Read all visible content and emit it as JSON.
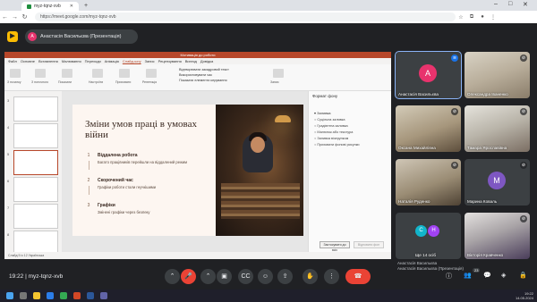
{
  "browser": {
    "tab_title": "myz-tqnz-xvb",
    "url": "https://meet.google.com/myz-tqnz-xvb",
    "new_tab": "+",
    "win_controls": [
      "–",
      "□",
      "✕"
    ],
    "nav": [
      "←",
      "→",
      "↻"
    ]
  },
  "meet": {
    "presenter_label": "Анастасія Васильєва (Презентація)",
    "presenter_initial": "А",
    "meeting_code": "myz-tqnz-xvb",
    "time": "19:22",
    "separator": "|",
    "pres_note": [
      "Анастасія Васильєва",
      "Анастасія Васильєва (Презентація)"
    ],
    "participant_count": "23"
  },
  "powerpoint": {
    "window_title": "Мотивація до роботи",
    "menu": [
      "Файл",
      "Основне",
      "Вставлення",
      "Малювання",
      "Переходи",
      "Анімація",
      "Слайд-шоу",
      "Запис",
      "Рецензування",
      "Вигляд",
      "Довідка"
    ],
    "active_menu": "Слайд-шоу",
    "ribbon_labels": [
      "З початку",
      "З поточного",
      "Показати",
      "Настроїти",
      "Приховати",
      "Репетиція",
      "Запис"
    ],
    "ribbon_checks": [
      "Відтворювати закадровий текст",
      "Використовувати час",
      "Показати елементи керування"
    ],
    "status": "Слайд 5 із 12   Українська",
    "slide_numbers": [
      "3",
      "4",
      "5",
      "6",
      "7",
      "8"
    ],
    "design_pane": {
      "title": "Формат фону",
      "section": "▾ Заливка",
      "options": [
        "Суцільна заливка",
        "Градієнтна заливка",
        "Малюнок або текстура",
        "Заливка візерунком",
        "Приховати фонові рисунки"
      ],
      "apply_all": "Застосувати до всіх",
      "reset": "Відновити фон"
    },
    "slide": {
      "title": "Зміни умов праці в умовах війни",
      "items": [
        {
          "num": "1",
          "head": "Віддалена робота",
          "desc": "Багато працівників перейшли на віддалений режим"
        },
        {
          "num": "2",
          "head": "Скорочений час",
          "desc": "Графіки роботи стали гнучкішими"
        },
        {
          "num": "3",
          "head": "Графіки",
          "desc": "Змінені графіки через безпеку"
        }
      ]
    }
  },
  "participants": [
    {
      "name": "Анастасія Васильєва",
      "initial": "А",
      "color": "#e8336d",
      "type": "avatar",
      "active": true
    },
    {
      "name": "Олександра Іваненко",
      "type": "video",
      "muted": true
    },
    {
      "name": "Оксана Михайлівна",
      "type": "video",
      "muted": true
    },
    {
      "name": "Тамара Ярославівна",
      "type": "video",
      "muted": true
    },
    {
      "name": "Наталія Руденко",
      "type": "video",
      "muted": true
    },
    {
      "name": "Марина Коваль",
      "initial": "М",
      "color": "#7e57c2",
      "type": "avatar",
      "muted": true
    },
    {
      "name": "Ще 14 осіб",
      "initials": [
        "С",
        "Н"
      ],
      "type": "group"
    },
    {
      "name": "Вікторія Кравченко",
      "type": "video",
      "muted": true
    }
  ],
  "controls": {
    "mic": "🎤",
    "camera": "▣",
    "captions": "CC",
    "emoji": "☺",
    "present": "⇪",
    "raise_hand": "✋",
    "more": "⋮",
    "end_call": "☎",
    "info": "ⓘ",
    "people": "👥",
    "chat": "💬",
    "activities": "◈",
    "lock": "🔒"
  },
  "taskbar_time": [
    "19:22",
    "14.05.2024"
  ]
}
